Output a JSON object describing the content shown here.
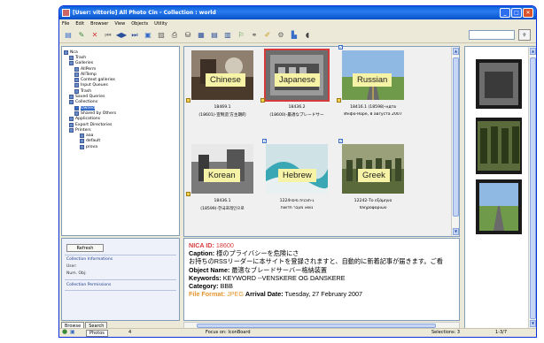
{
  "window": {
    "title": "[User: vittorio] All Photo Cin - Collection : world"
  },
  "menu": [
    "File",
    "Edit",
    "Browser",
    "View",
    "Objects",
    "Utility"
  ],
  "toolbar_icons": [
    "add-icon",
    "tag-icon",
    "delete-icon",
    "first-icon",
    "prev-next-icon",
    "last-icon",
    "edit-icon",
    "edit2-icon",
    "print-icon",
    "export-icon",
    "view-grid-icon",
    "view-list-icon",
    "view-detail-icon",
    "map-icon",
    "link-icon",
    "pen-icon",
    "gear-icon",
    "chart-icon",
    "speaker-icon"
  ],
  "tree": [
    {
      "label": "Nca",
      "level": 0
    },
    {
      "label": "Trash",
      "level": 1
    },
    {
      "label": "Galleries",
      "level": 1
    },
    {
      "label": "AllPerm",
      "level": 2
    },
    {
      "label": "AllTemp",
      "level": 2
    },
    {
      "label": "Context galleries",
      "level": 2
    },
    {
      "label": "Input Queues",
      "level": 2
    },
    {
      "label": "Trash",
      "level": 2
    },
    {
      "label": "Saved Queries",
      "level": 1
    },
    {
      "label": "Collections",
      "level": 1
    },
    {
      "label": "Owned",
      "level": 2,
      "selected": true
    },
    {
      "label": "Shared by Others",
      "level": 2
    },
    {
      "label": "Applications",
      "level": 1
    },
    {
      "label": "Export Directories",
      "level": 1
    },
    {
      "label": "Printers",
      "level": 1
    },
    {
      "label": "aaa",
      "level": 3
    },
    {
      "label": "default",
      "level": 3
    },
    {
      "label": "prova",
      "level": 3
    }
  ],
  "info": {
    "refresh": "Refresh",
    "collection_info": "Collection Informations",
    "user": "User:",
    "num_obj": "Num. Obj:",
    "collection_perm": "Collection Permissions"
  },
  "bottom_tabs": [
    "Browse",
    "Search"
  ],
  "thumbnails": [
    {
      "id": "18469.1",
      "caption": "(18601)-宣制造'方主期的",
      "lang": "Chinese"
    },
    {
      "id": "18436.2",
      "caption": "(18600)-最適なプレードサー",
      "lang": "Japanese",
      "selected": true
    },
    {
      "id": "18416.1 (18598)-ндтв",
      "caption": "Инфо-Rope, 8 августа 2007",
      "lang": "Russian"
    },
    {
      "id": "18436.1",
      "caption": "(18599)-한국프레인으로",
      "lang": "Korean"
    },
    {
      "id": "1224ג-תוכנית מיסוי",
      "caption": "נושא מעבר חדשות",
      "lang": "Hebrew"
    },
    {
      "id": "12242-Το εξάμηνο",
      "caption": "πληροφοριών",
      "lang": "Greek"
    }
  ],
  "meta": {
    "nica_label": "NICA ID:",
    "nica_value": "18600",
    "caption_label": "Caption:",
    "caption_value": "様のプライバシーを危険にさ",
    "line2": "お持ちのRSSリーダーに本サイトを登録されますと、自動的に新着記事が届きます。ご看",
    "objname_label": "Object Name:",
    "objname_value": "最適なブレードサーバー格納装置",
    "keywords_label": "Keywords:",
    "keywords_value": "KEYWORD --VENSKERE OG DANSKERE",
    "category_label": "Category:",
    "category_value": "BBB",
    "format_label": "File Format:",
    "format_value": "JPEG",
    "arrival_label": "Arrival Date:",
    "arrival_value": "Tuesday, 27 February 2007"
  },
  "status": {
    "page_field": "Photos",
    "page_num": "4",
    "focus": "Focus on: IconBoard",
    "selections": "Selections: 3",
    "range": "1-3/7"
  },
  "colors": {
    "accent": "#d43a3a",
    "format": "#e3952b",
    "titlebar": "#0a5fd8"
  }
}
